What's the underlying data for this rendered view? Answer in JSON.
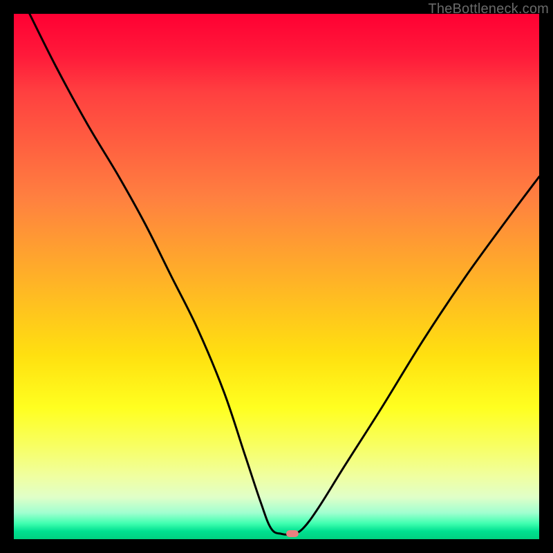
{
  "watermark": "TheBottleneck.com",
  "chart_data": {
    "type": "line",
    "title": "",
    "xlabel": "",
    "ylabel": "",
    "xlim": [
      0,
      100
    ],
    "ylim": [
      0,
      100
    ],
    "grid": false,
    "legend": false,
    "background_gradient": {
      "direction": "vertical",
      "stops": [
        {
          "pos": 0,
          "color": "#ff0033"
        },
        {
          "pos": 50,
          "color": "#ffc020"
        },
        {
          "pos": 80,
          "color": "#ffff40"
        },
        {
          "pos": 100,
          "color": "#00d080"
        }
      ]
    },
    "marker": {
      "x": 53,
      "y": 1,
      "color": "#e88080"
    },
    "series": [
      {
        "name": "bottleneck-curve",
        "x": [
          3,
          8,
          14,
          20,
          25,
          30,
          35,
          40,
          44,
          47,
          49,
          51,
          53,
          55,
          58,
          63,
          70,
          78,
          86,
          94,
          100
        ],
        "y": [
          100,
          90,
          79,
          69,
          60,
          50,
          40,
          28,
          16,
          7,
          2,
          1,
          1,
          2,
          6,
          14,
          25,
          38,
          50,
          61,
          69
        ]
      }
    ]
  }
}
